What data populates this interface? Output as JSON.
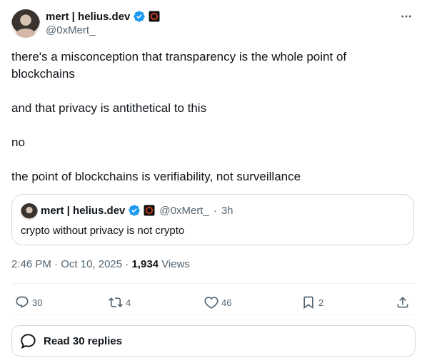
{
  "tweet": {
    "author_name": "mert | helius.dev",
    "author_handle": "@0xMert_",
    "paragraphs": [
      "there's a misconception that transparency is the whole point of blockchains",
      "and that privacy is antithetical to this",
      "no",
      "the point of blockchains is verifiability, not surveillance"
    ],
    "time": "2:46 PM",
    "date": "Oct 10, 2025",
    "views_count": "1,934",
    "views_label": "Views"
  },
  "quote": {
    "author_name": "mert | helius.dev",
    "author_handle": "@0xMert_",
    "age": "3h",
    "text": "crypto without privacy is not crypto"
  },
  "actions": {
    "replies": "30",
    "reposts": "4",
    "likes": "46",
    "bookmarks": "2"
  },
  "read_replies_label": "Read 30 replies",
  "colors": {
    "text": "#0f1419",
    "secondary": "#536471",
    "verified": "#1d9bf0",
    "border": "#cfd9de"
  }
}
